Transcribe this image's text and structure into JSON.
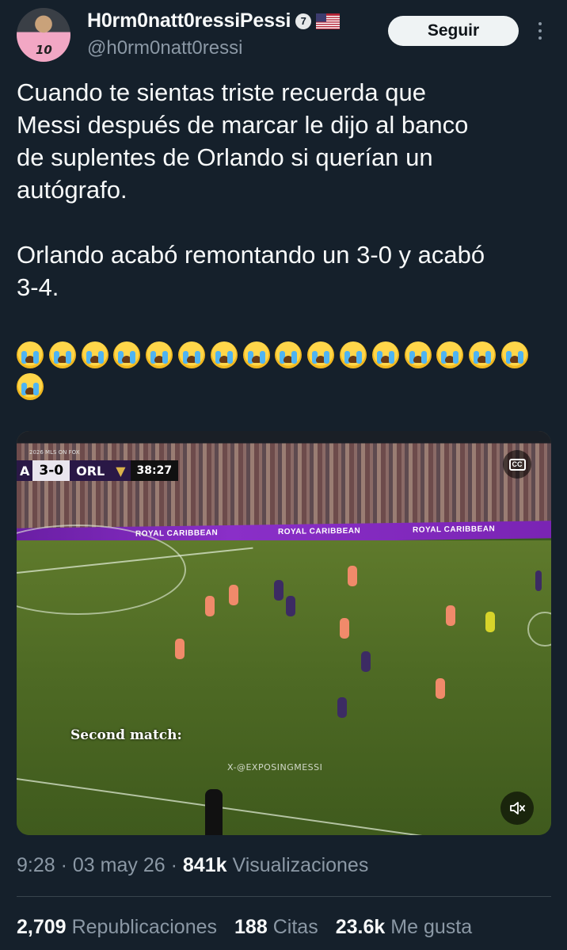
{
  "author": {
    "display_name": "H0rm0natt0ressiPessi",
    "badge": "7",
    "handle": "@h0rm0natt0ressi",
    "avatar_number": "10"
  },
  "follow_label": "Seguir",
  "tweet": {
    "text": "Cuando te sientas triste recuerda que\nMessi después de marcar le dijo al banco\nde suplentes de Orlando si querían un\nautógrafo.\n\nOrlando acabó remontando un 3-0 y acabó\n3-4.",
    "emoji_name": "loudly-crying-face",
    "emoji_count": 17
  },
  "video": {
    "scorebug": {
      "league": "2026 MLS ON FOX",
      "home": "A",
      "score": "3-0",
      "away": "ORL",
      "clock": "38:27"
    },
    "board_text": "ROYAL CARIBBEAN",
    "overlay_text": "Second match:",
    "watermark": "X-@EXPOSINGMESSI",
    "cc_label": "CC"
  },
  "meta": {
    "time": "9:28",
    "date": "03 may 26",
    "views_count": "841k",
    "views_label": "Visualizaciones"
  },
  "stats": {
    "reposts_count": "2,709",
    "reposts_label": "Republicaciones",
    "quotes_count": "188",
    "quotes_label": "Citas",
    "likes_count": "23.6k",
    "likes_label": "Me gusta"
  },
  "colors": {
    "background": "#15202b",
    "text": "#f7f9f9",
    "secondary": "#8b98a5",
    "divider": "#38444d"
  }
}
